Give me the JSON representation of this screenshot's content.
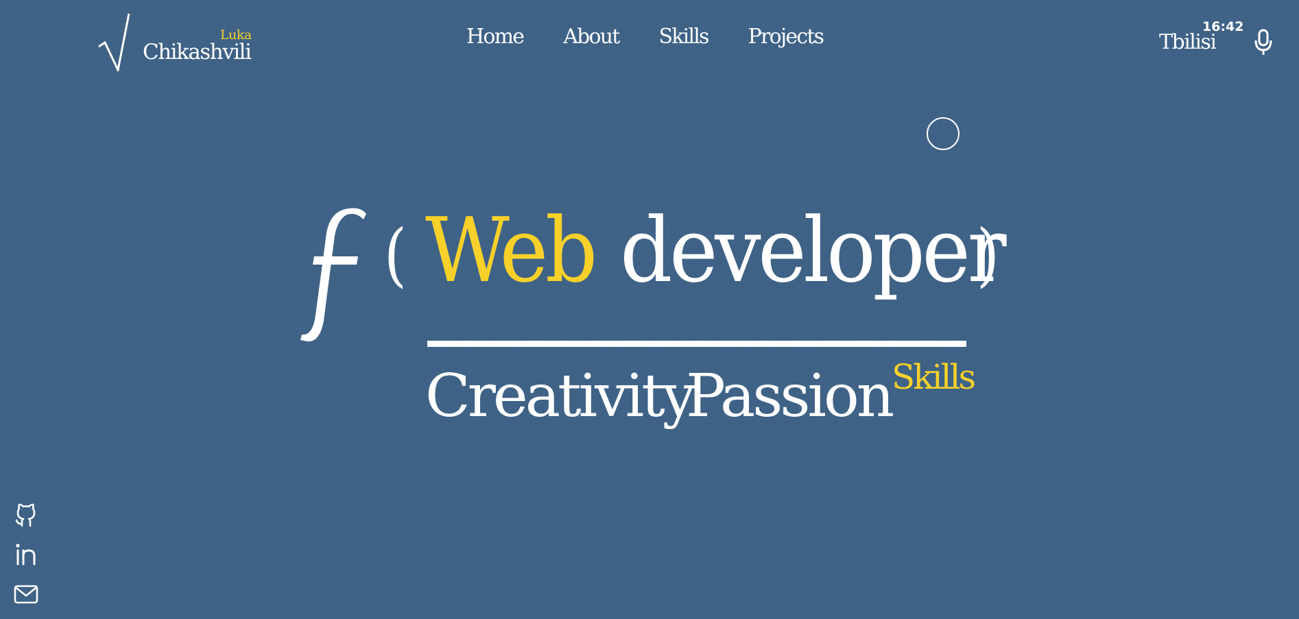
{
  "logo": {
    "symbol": "√",
    "first_name": "Luka",
    "last_name": "Chikashvili"
  },
  "nav": {
    "items": [
      "Home",
      "About",
      "Skills",
      "Projects"
    ]
  },
  "header_right": {
    "city": "Tbilisi",
    "time": "16:42",
    "mic_icon": "microphone-icon"
  },
  "hero": {
    "function_symbol": "f",
    "open_paren": "(",
    "close_paren": ")",
    "highlight": "Web",
    "role": "developer",
    "denominator": [
      "Creativity",
      "Passion",
      "Skills"
    ]
  },
  "social": {
    "icons": [
      "github-icon",
      "linkedin-icon",
      "mail-icon"
    ]
  },
  "colors": {
    "background": "#3e6286",
    "accent": "#f7d12a",
    "text": "#ffffff"
  }
}
